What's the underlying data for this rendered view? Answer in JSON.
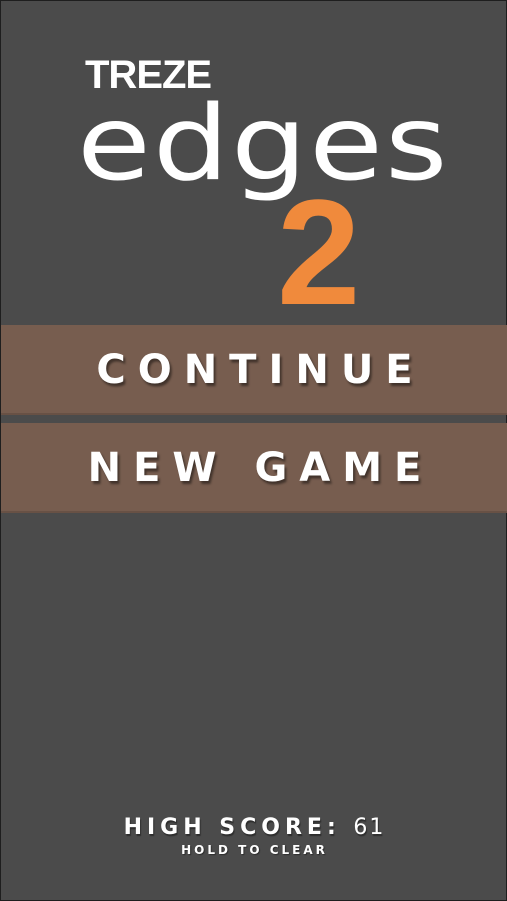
{
  "logo": {
    "brand": "TREZE",
    "title": "edges",
    "number": "2"
  },
  "menu": {
    "continue_label": "CONTINUE",
    "new_game_label": "NEW GAME"
  },
  "score": {
    "label": "HIGH SCORE:",
    "value": "61",
    "hint": "HOLD TO CLEAR"
  },
  "colors": {
    "background": "#4b4b4b",
    "button": "#775d4f",
    "accent": "#f08a3c",
    "text": "#ffffff"
  }
}
